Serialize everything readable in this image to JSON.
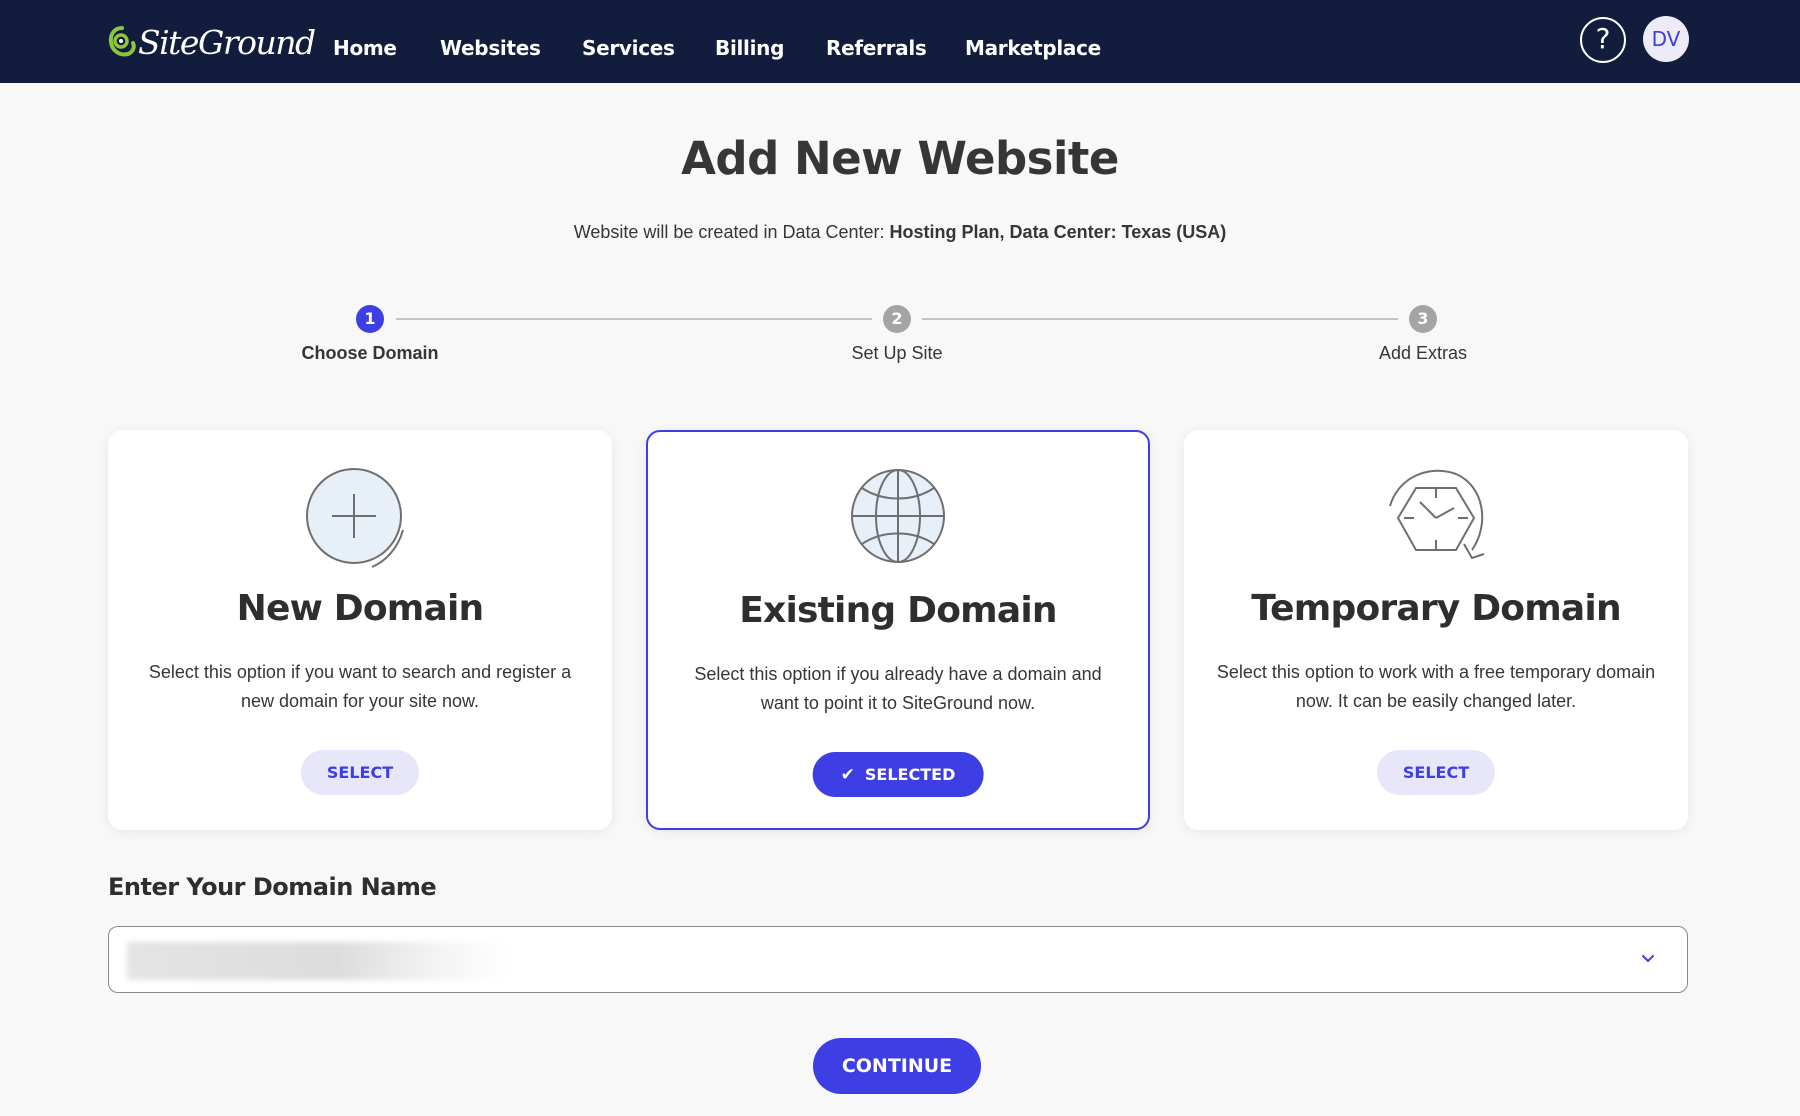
{
  "header": {
    "brand": "SiteGround",
    "nav": [
      "Home",
      "Websites",
      "Services",
      "Billing",
      "Referrals",
      "Marketplace"
    ],
    "help_label": "?",
    "avatar_initials": "DV"
  },
  "page": {
    "title": "Add New Website",
    "subtitle_prefix": "Website will be created in Data Center: ",
    "subtitle_bold": "Hosting Plan, Data Center: Texas (USA)"
  },
  "stepper": {
    "current_step": 1,
    "steps": [
      {
        "number": "1",
        "label": "Choose Domain",
        "state": "active"
      },
      {
        "number": "2",
        "label": "Set Up Site",
        "state": "inactive"
      },
      {
        "number": "3",
        "label": "Add Extras",
        "state": "inactive"
      }
    ]
  },
  "options": [
    {
      "title": "New Domain",
      "description": "Select this option if you want to search and register a new domain for your site now.",
      "button": "SELECT",
      "selected": false,
      "icon": "plus-circle-icon"
    },
    {
      "title": "Existing Domain",
      "description": "Select this option if you already have a domain and want to point it to SiteGround now.",
      "button": "SELECTED",
      "selected": true,
      "icon": "globe-icon"
    },
    {
      "title": "Temporary Domain",
      "description": "Select this option to work with a free temporary domain now. It can be easily changed later.",
      "button": "SELECT",
      "selected": false,
      "icon": "clock-refresh-icon"
    }
  ],
  "domain": {
    "label": "Enter Your Domain Name",
    "value": "[blurred]"
  },
  "actions": {
    "continue": "CONTINUE"
  },
  "colors": {
    "header_bg": "#121c3c",
    "accent": "#3d3ee3",
    "accent_light": "#e8e6f9",
    "logo_green": "#8cc63f"
  }
}
